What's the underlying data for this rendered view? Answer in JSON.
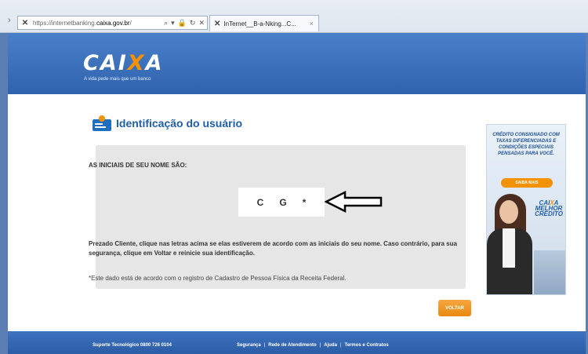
{
  "browser": {
    "url_prefix": "https://internetbanking.",
    "url_domain": "caixa.gov.br",
    "url_rest": "/",
    "tab_title": "InTernet__B-a-Nking...C...",
    "tab_close": "×",
    "address_controls": [
      "⌕",
      "▾",
      "🔒",
      "↻",
      "✕"
    ]
  },
  "header": {
    "logo_left": "CAI",
    "logo_x": "X",
    "logo_right": "A",
    "tagline": "A vida pede mais que um banco"
  },
  "page": {
    "title": "Identificação do usuário"
  },
  "panel": {
    "initials_label": "AS INICIAIS DE SEU NOME SÃO:",
    "initials": [
      "C",
      "G",
      "*"
    ],
    "instructions": "Prezado Cliente, clique nas letras acima se elas estiverem de acordo com as iniciais do seu nome. Caso contrário, para sua segurança, clique em Voltar e reinicie sua identificação.",
    "note": "*Este dado está de acordo com o registro de Cadastro de Pessoa Física da Receita Federal."
  },
  "actions": {
    "voltar_label": "VOLTAR"
  },
  "ad": {
    "headline": "CRÉDITO CONSIGNADO COM TAXAS DIFERENCIADAS E CONDIÇÕES ESPECIAIS PENSADAS PARA VOCÊ.",
    "button": "SAIBA MAIS",
    "logo_left": "CAI",
    "logo_x": "X",
    "logo_right": "A",
    "logo_sub1": "MELHOR",
    "logo_sub2": "CRÉDITO"
  },
  "footer": {
    "support": "Suporte Tecnológico 0800 726 0104",
    "links": [
      "Segurança",
      "Rede de Atendimento",
      "Ajuda",
      "Termos e Contratos"
    ]
  },
  "colors": {
    "brand_blue": "#2f63ad",
    "accent_orange": "#f39200",
    "title_blue": "#1f5fa8",
    "panel_gray": "#e6e6e6"
  }
}
